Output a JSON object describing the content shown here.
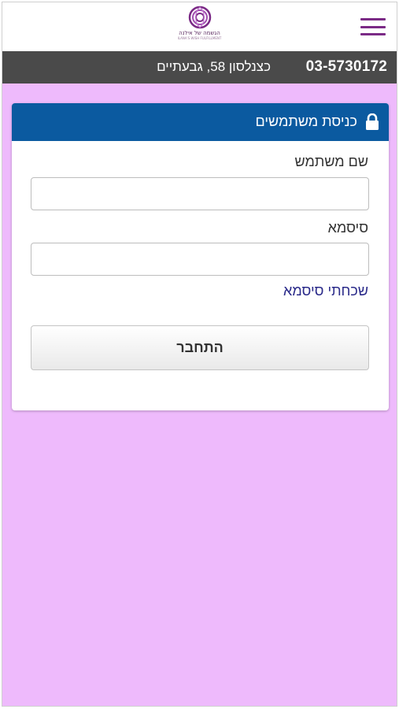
{
  "header": {
    "logo_text": "הגשמה של אילנה",
    "logo_subtext": "ILANA'S WISH FULFILLMENT",
    "menu_icon": "hamburger-menu-icon"
  },
  "contact": {
    "phone": "03-5730172",
    "address": "כצנלסון 58, גבעתיים"
  },
  "login": {
    "title": "כניסת משתמשים",
    "title_icon": "lock-icon",
    "username_label": "שם משתמש",
    "username_value": "",
    "password_label": "סיסמא",
    "password_value": "",
    "forgot_password": "שכחתי סיסמא",
    "submit_label": "התחבר"
  },
  "colors": {
    "page_background": "#eebafc",
    "info_bar": "#4a4a4a",
    "card_header": "#0b5aa0",
    "menu_icon": "#7b2a86"
  }
}
